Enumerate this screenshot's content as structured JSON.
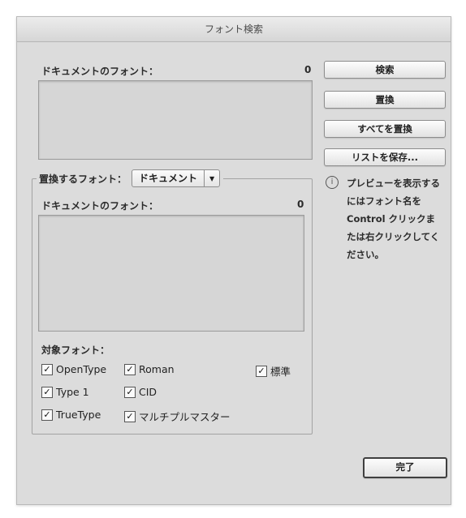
{
  "window": {
    "title": "フォント検索"
  },
  "document_fonts": {
    "label": "ドキュメントのフォント：",
    "count": "0"
  },
  "replace_group": {
    "label": "置換するフォント：",
    "source_select": "ドキュメント",
    "list_label": "ドキュメントのフォント：",
    "count": "0"
  },
  "buttons": {
    "find": "検索",
    "replace": "置換",
    "replace_all": "すべてを置換",
    "save_list": "リストを保存...",
    "done": "完了"
  },
  "info": {
    "icon": "info-icon",
    "text": "プレビューを表示するにはフォント名をControl クリックまたは右クリックしてください。"
  },
  "target_fonts": {
    "label": "対象フォント：",
    "options": [
      {
        "label": "OpenType",
        "checked": true
      },
      {
        "label": "Roman",
        "checked": true
      },
      {
        "label": "標準",
        "checked": true
      },
      {
        "label": "Type 1",
        "checked": true
      },
      {
        "label": "CID",
        "checked": true
      },
      {
        "label": "TrueType",
        "checked": true
      },
      {
        "label": "マルチプルマスター",
        "checked": true
      }
    ]
  }
}
